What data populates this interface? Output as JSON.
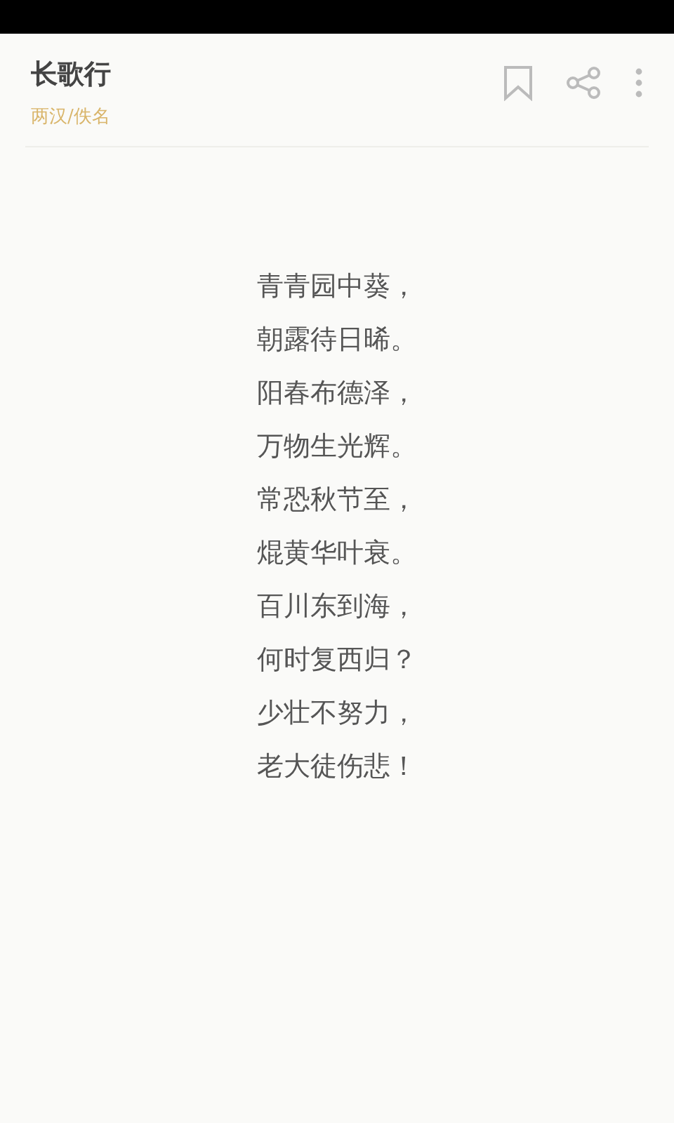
{
  "header": {
    "title": "长歌行",
    "meta": "两汉/佚名"
  },
  "poem": {
    "lines": [
      "青青园中葵，",
      "朝露待日晞。",
      "阳春布德泽，",
      "万物生光辉。",
      "常恐秋节至，",
      "焜黄华叶衰。",
      "百川东到海，",
      "何时复西归？",
      "少壮不努力，",
      "老大徒伤悲！"
    ]
  }
}
